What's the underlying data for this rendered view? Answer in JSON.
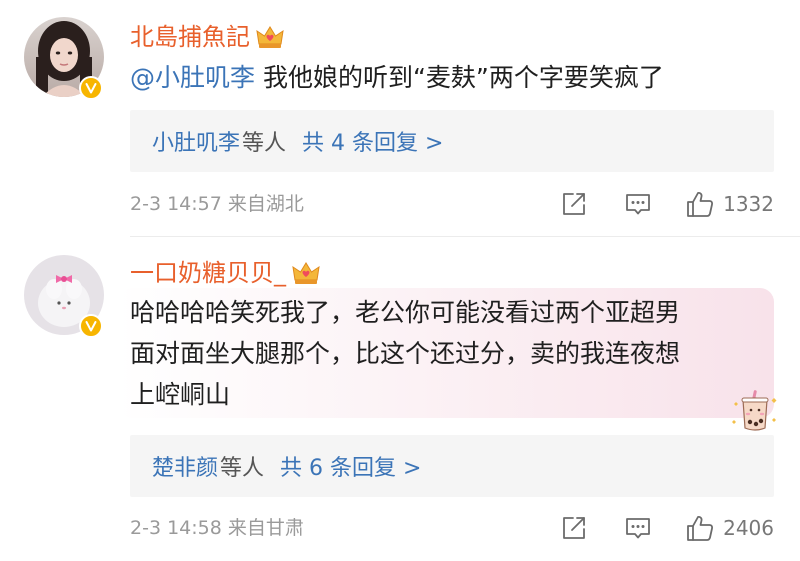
{
  "comments": [
    {
      "username": "北島捕魚記",
      "mention": "@小肚叽李",
      "text": " 我他娘的听到“麦麸”两个字要笑疯了",
      "replies": {
        "names": "小肚叽李",
        "suffix": "等人",
        "count": "共 4 条回复 >"
      },
      "meta": "2-3 14:57  来自湖北",
      "likes": "1332"
    },
    {
      "username": "一口奶糖贝贝_",
      "text_lines": [
        "哈哈哈哈笑死我了，老公你可能没看过两个亚超男",
        "面对面坐大腿那个，比这个还过分，卖的我连夜想",
        "上崆峒山"
      ],
      "replies": {
        "names": "楚非颜",
        "suffix": "等人",
        "count": "共 6 条回复 >"
      },
      "meta": "2-3 14:58  来自甘肃",
      "likes": "2406"
    }
  ],
  "colors": {
    "username": "#e8602c",
    "link": "#3b74b7",
    "meta": "#9a9a9a",
    "verified": "#f7b500"
  },
  "icons": [
    "share-icon",
    "comment-icon",
    "thumbs-up-icon",
    "crown-badge-icon",
    "verified-badge-icon",
    "milk-tea-sticker-icon"
  ]
}
